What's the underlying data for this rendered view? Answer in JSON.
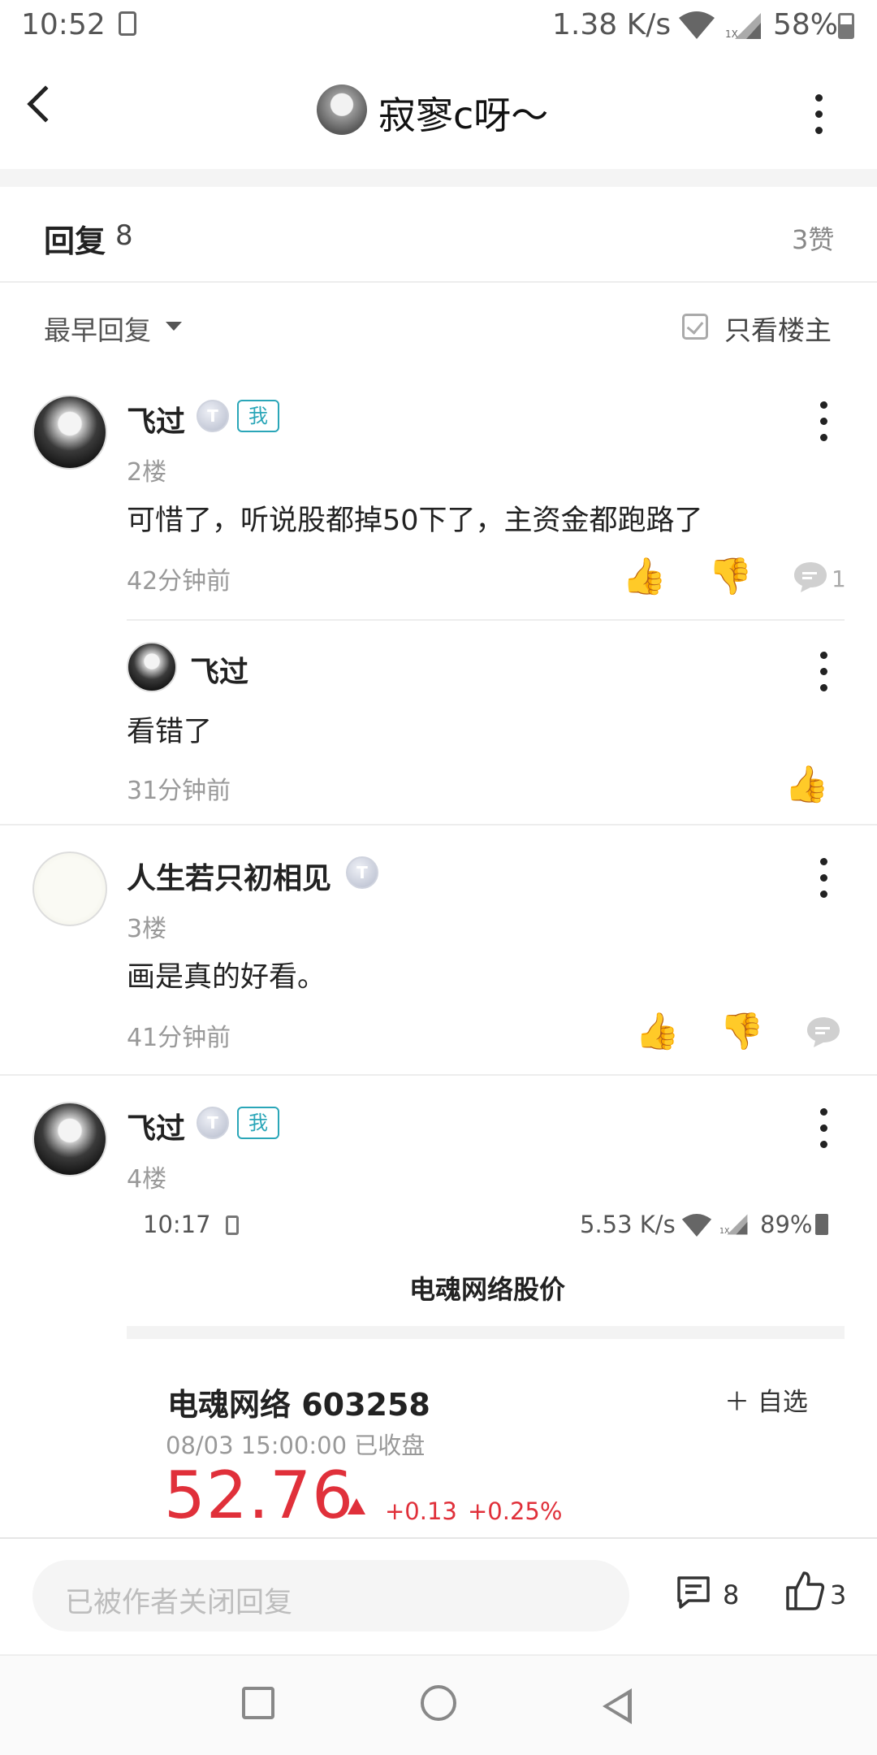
{
  "status_bar": {
    "time": "10:52",
    "speed": "1.38 K/s",
    "network": "1X",
    "battery": "58%"
  },
  "header": {
    "title": "寂寥c呀～"
  },
  "reply_header": {
    "title": "回复",
    "count": "8",
    "likes": "3赞"
  },
  "filter": {
    "sort_label": "最早回复",
    "only_op_label": "只看楼主"
  },
  "comments": [
    {
      "user": "飞过",
      "level_icon": "T",
      "me_badge": "我",
      "floor": "2楼",
      "text": "可惜了，听说股都掉50下了，主资金都跑路了",
      "time": "42分钟前",
      "reply_count": "1"
    },
    {
      "user": "人生若只初相见",
      "level_icon": "T",
      "floor": "3楼",
      "text": "画是真的好看。",
      "time": "41分钟前"
    },
    {
      "user": "飞过",
      "level_icon": "T",
      "me_badge": "我",
      "floor": "4楼"
    }
  ],
  "sub_reply": {
    "user": "飞过",
    "text": "看错了",
    "time": "31分钟前"
  },
  "embedded": {
    "status_time": "10:17",
    "status_speed": "5.53 K/s",
    "status_network": "1X",
    "status_battery": "89%",
    "title": "电魂网络股价",
    "stock_name": "电魂网络 603258",
    "add_label": "＋ 自选",
    "date": "08/03 15:00:00 已收盘",
    "price": "52.76",
    "change": "+0.13",
    "change_pct": "+0.25%"
  },
  "bottom_bar": {
    "input_placeholder": "已被作者关闭回复",
    "comment_count": "8",
    "like_count": "3"
  },
  "colors": {
    "accent_red": "#e0303a",
    "me_badge": "#2aa6b8"
  }
}
